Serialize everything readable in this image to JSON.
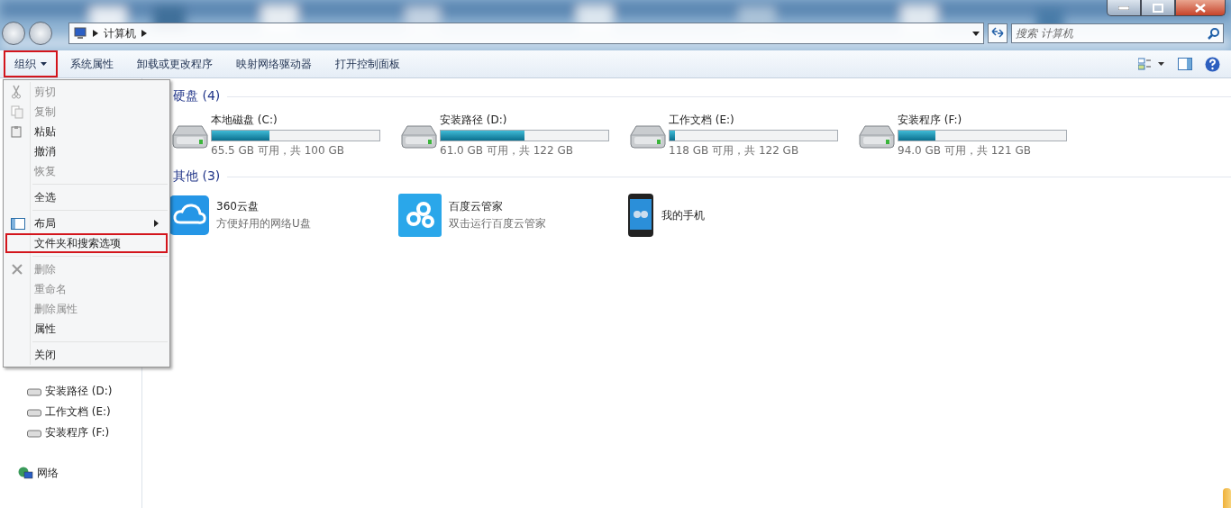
{
  "window": {
    "controls": [
      {
        "kind": "minimize"
      },
      {
        "kind": "maximize"
      },
      {
        "kind": "close"
      }
    ]
  },
  "address_bar": {
    "path": [
      "计算机"
    ],
    "search": {
      "placeholder": "搜索 计算机"
    }
  },
  "toolbar": {
    "items": [
      {
        "label": "组织",
        "kind": "menu",
        "highlighted": true
      },
      {
        "label": "系统属性",
        "kind": "plain",
        "highlighted": false
      },
      {
        "label": "卸载或更改程序",
        "kind": "plain",
        "highlighted": false
      },
      {
        "label": "映射网络驱动器",
        "kind": "plain",
        "highlighted": false
      },
      {
        "label": "打开控制面板",
        "kind": "plain",
        "highlighted": false
      }
    ]
  },
  "sidebar": {
    "items": [
      {
        "label": "安装路径 (D:)",
        "kind": "drive"
      },
      {
        "label": "工作文档 (E:)",
        "kind": "drive"
      },
      {
        "label": "安装程序 (F:)",
        "kind": "drive"
      },
      {
        "label": "网络",
        "kind": "network"
      }
    ]
  },
  "groups": [
    {
      "title": "硬盘 (4)",
      "kind": "drives",
      "items": [
        {
          "name": "本地磁盘 (C:)",
          "level": 0.345,
          "free": "65.5 GB 可用，共 100 GB"
        },
        {
          "name": "安装路径 (D:)",
          "level": 0.5,
          "free": "61.0 GB 可用，共 122 GB"
        },
        {
          "name": "工作文档 (E:)",
          "level": 0.033,
          "free": "118 GB 可用，共 122 GB"
        },
        {
          "name": "安装程序 (F:)",
          "level": 0.223,
          "free": "94.0 GB 可用，共 121 GB"
        }
      ]
    },
    {
      "title": "其他 (3)",
      "kind": "devices",
      "items": [
        {
          "name": "360云盘",
          "subtitle": "方便好用的网络U盘",
          "kind": "cloud"
        },
        {
          "name": "百度云管家",
          "subtitle": "双击运行百度云管家",
          "kind": "baidu"
        },
        {
          "name": "我的手机",
          "kind": "phone"
        }
      ]
    }
  ],
  "menu": {
    "items": [
      {
        "kind": "item",
        "label": "剪切",
        "disabled": true,
        "highlighted": false
      },
      {
        "kind": "item",
        "label": "复制",
        "disabled": true,
        "highlighted": false
      },
      {
        "kind": "item",
        "label": "粘贴",
        "disabled": false,
        "highlighted": false
      },
      {
        "kind": "item",
        "label": "撤消",
        "disabled": false,
        "highlighted": false
      },
      {
        "kind": "item",
        "label": "恢复",
        "disabled": true,
        "highlighted": false
      },
      {
        "kind": "separator"
      },
      {
        "kind": "item",
        "label": "全选",
        "disabled": false,
        "highlighted": false
      },
      {
        "kind": "separator"
      },
      {
        "kind": "submenu",
        "label": "布局",
        "disabled": false,
        "highlighted": false
      },
      {
        "kind": "item",
        "label": "文件夹和搜索选项",
        "disabled": false,
        "highlighted": true
      },
      {
        "kind": "separator"
      },
      {
        "kind": "item",
        "label": "删除",
        "disabled": true,
        "highlighted": false
      },
      {
        "kind": "item",
        "label": "重命名",
        "disabled": true,
        "highlighted": false
      },
      {
        "kind": "item",
        "label": "删除属性",
        "disabled": true,
        "highlighted": false
      },
      {
        "kind": "item",
        "label": "属性",
        "disabled": false,
        "highlighted": false
      },
      {
        "kind": "separator"
      },
      {
        "kind": "item",
        "label": "关闭",
        "disabled": false,
        "highlighted": false
      }
    ]
  }
}
